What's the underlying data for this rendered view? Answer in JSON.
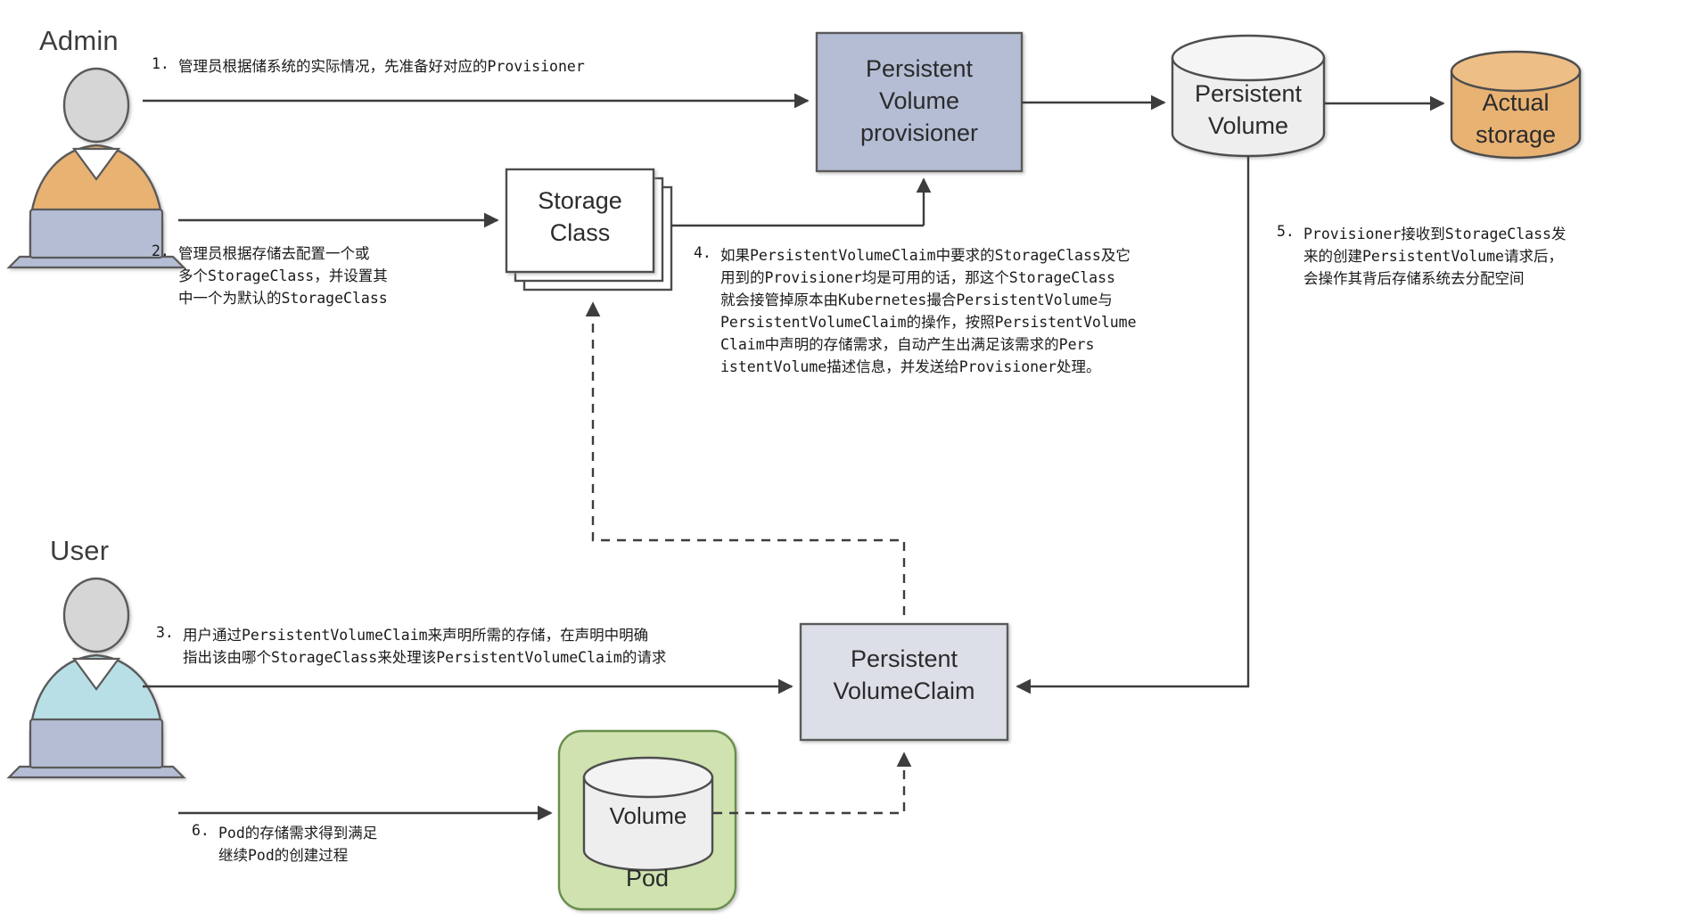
{
  "diagram": {
    "title": "Kubernetes Dynamic Persistent Volume Provisioning Flow",
    "actors": [
      {
        "id": "admin",
        "label": "Admin",
        "body_color": "#e8b273",
        "head_color": "#d6d6d6",
        "laptop_color": "#b4bdd4"
      },
      {
        "id": "user",
        "label": "User",
        "body_color": "#b8dfe6",
        "head_color": "#d6d6d6",
        "laptop_color": "#b4bdd4"
      }
    ],
    "nodes": {
      "pv_provisioner": {
        "label": "Persistent\nVolume\nprovisioner",
        "shape": "rectangle",
        "fill": "#b4bdd4",
        "stroke": "#5a5a5a"
      },
      "storage_class": {
        "label": "Storage\nClass",
        "shape": "stacked-rectangle",
        "fill": "#ffffff",
        "stroke": "#4d4d4d"
      },
      "persistent_volume": {
        "label": "Persistent\nVolume",
        "shape": "cylinder",
        "fill": "#eeeeee",
        "stroke": "#4d4d4d"
      },
      "actual_storage": {
        "label": "Actual\nstorage",
        "shape": "cylinder",
        "fill": "#e8b273",
        "stroke": "#4d4d4d"
      },
      "pvc": {
        "label": "Persistent\nVolumeClaim",
        "shape": "rectangle",
        "fill": "#dcdfe8",
        "stroke": "#5a5a5a"
      },
      "pod": {
        "label": "Pod",
        "shape": "rounded-rectangle",
        "fill": "#cfe2b0",
        "stroke": "#6b8e4e"
      },
      "volume": {
        "label": "Volume",
        "shape": "cylinder",
        "fill": "#eeeeee",
        "stroke": "#4d4d4d"
      }
    },
    "steps": [
      {
        "id": "step-1",
        "number": "1.",
        "text": "管理员根据储系统的实际情况，先准备好对应的Provisioner"
      },
      {
        "id": "step-2",
        "number": "2.",
        "text": "管理员根据存储去配置一个或\n多个StorageClass，并设置其\n中一个为默认的StorageClass"
      },
      {
        "id": "step-3",
        "number": "3.",
        "text": "用户通过PersistentVolumeClaim来声明所需的存储，在声明中明确\n指出该由哪个StorageClass来处理该PersistentVolumeClaim的请求"
      },
      {
        "id": "step-4",
        "number": "4.",
        "text": "如果PersistentVolumeClaim中要求的StorageClass及它\n用到的Provisioner均是可用的话，那这个StorageClass\n就会接管掉原本由Kubernetes撮合PersistentVolume与\nPersistentVolumeClaim的操作，按照PersistentVolume\nClaim中声明的存储需求，自动产生出满足该需求的Pers\nistentVolume描述信息，并发送给Provisioner处理。"
      },
      {
        "id": "step-5",
        "number": "5.",
        "text": "Provisioner接收到StorageClass发\n来的创建PersistentVolume请求后，\n会操作其背后存储系统去分配空间"
      },
      {
        "id": "step-6",
        "number": "6.",
        "text": "Pod的存储需求得到满足\n继续Pod的创建过程"
      }
    ],
    "connectors": [
      {
        "id": "admin-to-provisioner",
        "style": "solid",
        "from": "admin",
        "to": "pv_provisioner"
      },
      {
        "id": "admin-to-storageclass",
        "style": "solid",
        "from": "admin",
        "to": "storage_class"
      },
      {
        "id": "provisioner-to-pv",
        "style": "solid",
        "from": "pv_provisioner",
        "to": "persistent_volume"
      },
      {
        "id": "pv-to-actual-storage",
        "style": "solid",
        "from": "persistent_volume",
        "to": "actual_storage"
      },
      {
        "id": "storageclass-to-provisioner",
        "style": "solid",
        "from": "storage_class",
        "to": "pv_provisioner"
      },
      {
        "id": "pv-to-pvc",
        "style": "solid",
        "from": "persistent_volume",
        "to": "pvc"
      },
      {
        "id": "user-to-pvc",
        "style": "solid",
        "from": "user",
        "to": "pvc"
      },
      {
        "id": "user-to-pod",
        "style": "solid",
        "from": "user",
        "to": "pod"
      },
      {
        "id": "pvc-to-storageclass",
        "style": "dashed",
        "from": "pvc",
        "to": "storage_class"
      },
      {
        "id": "volume-to-pvc",
        "style": "dashed",
        "from": "volume",
        "to": "pvc"
      }
    ],
    "colors": {
      "line": "#4d4d4d",
      "text": "#1a1a1a",
      "admin_body": "#e8b273",
      "user_body": "#b8dfe6",
      "provisioner_fill": "#b4bdd4",
      "pvc_fill": "#dcdfe8",
      "pod_fill": "#cfe2b0",
      "storage_fill": "#e8b273"
    }
  }
}
